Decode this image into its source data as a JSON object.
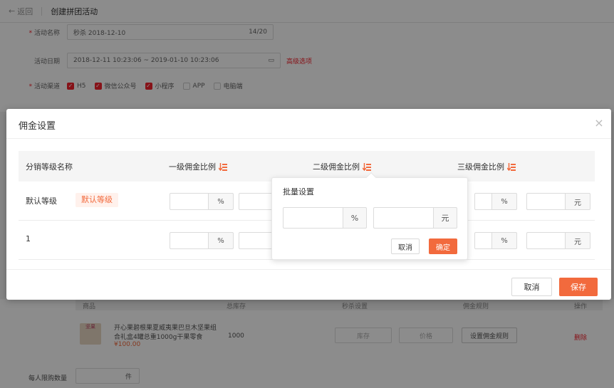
{
  "page": {
    "back_label": "返回",
    "title": "创建拼团活动",
    "activity_name_label": "活动名称",
    "activity_name_value": "秒杀 2018-12-10",
    "activity_name_count": "14/20",
    "date_label": "活动日期",
    "date_value": "2018-12-11 10:23:06 ~ 2019-01-10 10:23:06",
    "advanced_link": "高级选项",
    "channel_label": "活动渠道",
    "channels": [
      {
        "label": "H5",
        "checked": true
      },
      {
        "label": "微信公众号",
        "checked": true
      },
      {
        "label": "小程序",
        "checked": true
      },
      {
        "label": "APP",
        "checked": false
      },
      {
        "label": "电脑端",
        "checked": false
      }
    ],
    "product_table": {
      "headers": [
        "商品",
        "总库存",
        "秒杀设置",
        "佣金规则",
        "操作"
      ],
      "row": {
        "name_line1": "开心果碧根果夏威夷果巴旦木坚果组",
        "name_line2": "合礼盒4罐总重1000g干果零食",
        "price": "¥100.00",
        "stock": "1000",
        "stock_placeholder": "库存",
        "price_placeholder": "价格",
        "rule_button": "设置佣金规则",
        "delete": "删除",
        "img_label": "坚果"
      }
    },
    "limit_label": "每人限购数量",
    "limit_unit": "件"
  },
  "modal": {
    "title": "佣金设置",
    "close_icon": "×",
    "columns": [
      "分销等级名称",
      "一级佣金比例",
      "二级佣金比例",
      "三级佣金比例"
    ],
    "rows": [
      {
        "name": "默认等级",
        "tag": "默认等级"
      },
      {
        "name": "1",
        "tag": ""
      }
    ],
    "percent_unit": "%",
    "yuan_unit": "元",
    "cancel": "取消",
    "save": "保存"
  },
  "popover": {
    "title": "批量设置",
    "percent_unit": "%",
    "yuan_unit": "元",
    "cancel": "取消",
    "confirm": "确定"
  },
  "colors": {
    "accent": "#f26a3d",
    "danger": "#f5222d",
    "overlay": "rgba(0,0,0,0.45)"
  },
  "icons": {
    "sort": "sort-icon",
    "close": "close-icon",
    "back": "back-arrow-icon",
    "calendar": "calendar-icon"
  }
}
